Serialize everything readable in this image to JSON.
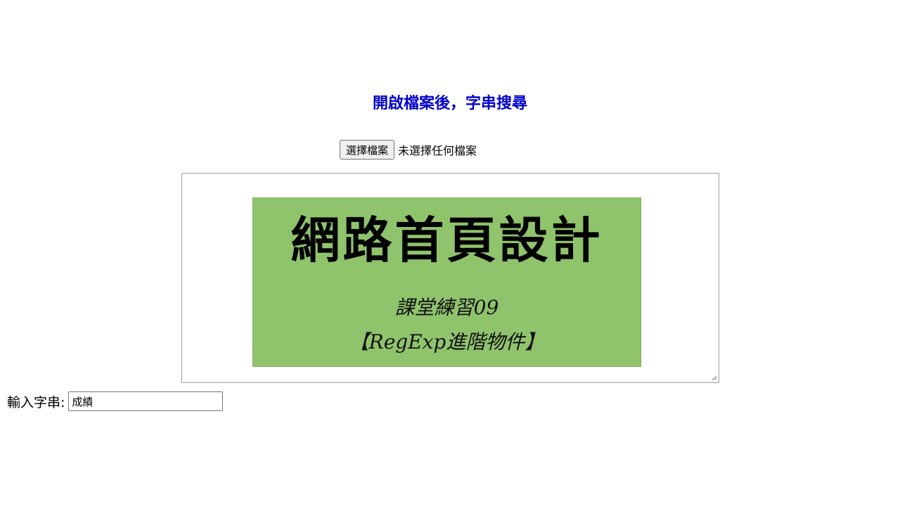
{
  "page": {
    "title": "開啟檔案後，字串搜尋"
  },
  "file_picker": {
    "button_label": "選擇檔案",
    "status": "未選擇任何檔案"
  },
  "content": {
    "banner_title": "網路首頁設計",
    "banner_line1": "課堂練習09",
    "banner_line2": "【RegExp進階物件】",
    "banner_color": "#8fc36c"
  },
  "search": {
    "label": "輸入字串:",
    "value": "成績"
  },
  "colors": {
    "title": "#0000cc"
  }
}
